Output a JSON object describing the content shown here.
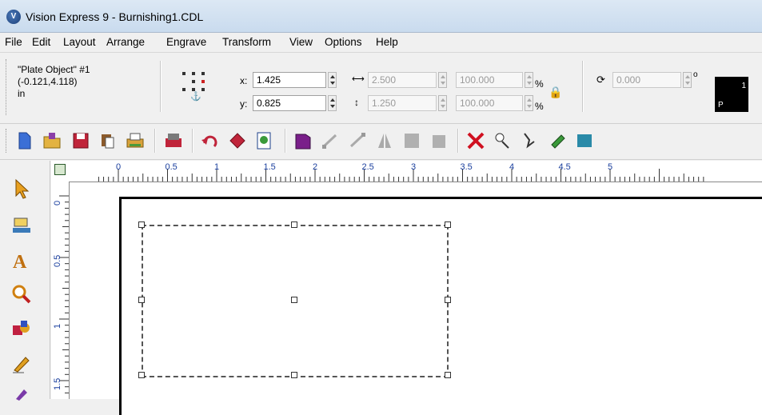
{
  "window": {
    "title": "Vision Express 9 - Burnishing1.CDL",
    "app_icon": "vision-express-logo-icon"
  },
  "menu": [
    {
      "label": "File"
    },
    {
      "label": "Edit"
    },
    {
      "label": "Layout"
    },
    {
      "label": "Arrange"
    },
    {
      "label": "Engrave"
    },
    {
      "label": "Transform"
    },
    {
      "label": "View"
    },
    {
      "label": "Options"
    },
    {
      "label": "Help"
    }
  ],
  "properties": {
    "object_name": "\"Plate Object\" #1",
    "object_coords": "(-0.121,4.118)",
    "units": "in",
    "x_label": "x:",
    "x_value": "1.425",
    "y_label": "y:",
    "y_value": "0.825",
    "width_value": "2.500",
    "height_value": "1.250",
    "scale_w": "100.000",
    "scale_h": "100.000",
    "percent": "%",
    "rotation_value": "0.000",
    "degree": "o",
    "swatch_top": "1",
    "swatch_bottom": "P"
  },
  "toolbar": {
    "buttons": [
      "new-document-icon",
      "open-folder-icon",
      "save-icon",
      "copy-icon",
      "print-icon",
      "engrave-icon",
      "undo-icon",
      "redo-icon",
      "zoom-page-icon",
      "plate-icon",
      "node-icon",
      "node2-icon",
      "mirror-icon",
      "group-icon",
      "ungroup-icon",
      "delete-nodes-icon",
      "tool-a-icon",
      "tool-b-icon",
      "tool-c-icon",
      "calculator-icon"
    ]
  },
  "ruler": {
    "h_labels": [
      "0",
      "0.5",
      "1",
      "1.5",
      "2",
      "2.5",
      "3",
      "3.5",
      "4",
      "4.5",
      "5"
    ],
    "v_labels": [
      "0",
      "0.5",
      "1",
      "1.5"
    ]
  },
  "tools": [
    "pointer-tool-icon",
    "engrave-tool-icon",
    "text-tool-icon",
    "zoom-tool-icon",
    "shapes-tool-icon",
    "pen-tool-icon",
    "paint-tool-icon"
  ],
  "colors": {
    "accent": "#1a3f9e",
    "titlebar": "#c9dbee"
  }
}
